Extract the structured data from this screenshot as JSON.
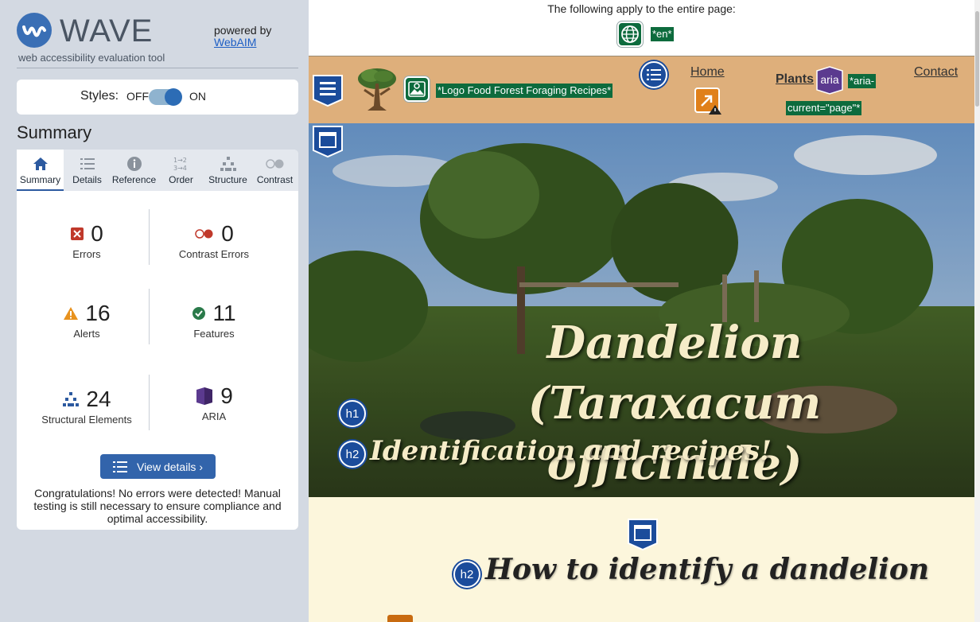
{
  "wave": {
    "logo_text": "WAVE",
    "logo_sub": "web accessibility evaluation tool",
    "powered_by": "powered by",
    "webaim": "WebAIM",
    "styles_label": "Styles:",
    "styles_off": "OFF",
    "styles_on": "ON",
    "summary_title": "Summary",
    "tabs": [
      {
        "label": "Summary",
        "icon": "home-icon"
      },
      {
        "label": "Details",
        "icon": "list-icon"
      },
      {
        "label": "Reference",
        "icon": "info-icon"
      },
      {
        "label": "Order",
        "icon": "order-icon"
      },
      {
        "label": "Structure",
        "icon": "structure-icon"
      },
      {
        "label": "Contrast",
        "icon": "contrast-icon"
      }
    ],
    "counts": {
      "errors": {
        "value": "0",
        "label": "Errors"
      },
      "contrast": {
        "value": "0",
        "label": "Contrast Errors"
      },
      "alerts": {
        "value": "16",
        "label": "Alerts"
      },
      "features": {
        "value": "11",
        "label": "Features"
      },
      "structural": {
        "value": "24",
        "label": "Structural Elements"
      },
      "aria": {
        "value": "9",
        "label": "ARIA"
      }
    },
    "view_details": "View details ›",
    "congrats": "Congratulations! No errors were detected! Manual testing is still necessary to ensure compliance and optimal accessibility.",
    "colors": {
      "accent": "#3264ab",
      "error": "#c0392b",
      "alert": "#e8921e",
      "feature": "#2a7a4a",
      "aria": "#5b3a8f"
    }
  },
  "page": {
    "note": "The following apply to the entire page:",
    "lang_label": "*en*",
    "logo_label": "*Logo Food Forest Foraging Recipes*",
    "nav": {
      "home": "Home",
      "plants": "Plants",
      "contact": "Contact"
    },
    "aria_badge": "aria",
    "aria_current_1": "*aria-",
    "aria_current_2": "current=\"page\"*",
    "hero_title": "Dandelion (Taraxacum officinale)",
    "hero_sub": "Identification and recipes!",
    "h1_badge": "h1",
    "h2_badge": "h2",
    "section_title": "How to identify a dandelion"
  }
}
